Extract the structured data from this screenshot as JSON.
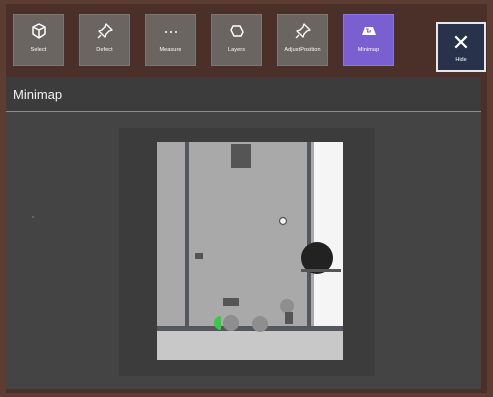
{
  "toolbar": {
    "buttons": [
      {
        "label": "Select",
        "icon": "cube-icon",
        "active": false
      },
      {
        "label": "Defect",
        "icon": "pin-icon",
        "active": false
      },
      {
        "label": "Measure",
        "icon": "ellipsis-icon",
        "active": false
      },
      {
        "label": "Layers",
        "icon": "layers-icon",
        "active": false
      },
      {
        "label": "AdjustPosition",
        "icon": "pin-icon",
        "active": false
      },
      {
        "label": "Minimap",
        "icon": "map-icon",
        "active": true
      }
    ],
    "hide": {
      "label": "Hide",
      "icon": "close-icon"
    }
  },
  "panel": {
    "title": "Minimap"
  },
  "colors": {
    "active": "#7a5fd1",
    "button": "#6b6561",
    "hide_bg": "#28324a",
    "player": "#33cc44"
  }
}
